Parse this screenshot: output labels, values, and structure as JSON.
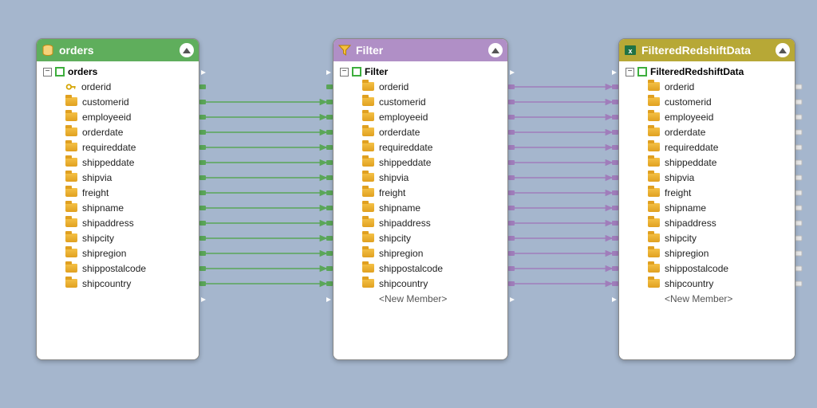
{
  "colors": {
    "bg": "#a5b6cd",
    "green": "#5fae5c",
    "purple": "#b08fc6",
    "olive": "#b7a836"
  },
  "panels": {
    "orders": {
      "title": "orders",
      "root": "orders",
      "rootToggle": "−",
      "fields": [
        "orderid",
        "customerid",
        "employeeid",
        "orderdate",
        "requireddate",
        "shippeddate",
        "shipvia",
        "freight",
        "shipname",
        "shipaddress",
        "shipcity",
        "shipregion",
        "shippostalcode",
        "shipcountry"
      ],
      "keyField": "orderid",
      "newMember": ""
    },
    "filter": {
      "title": "Filter",
      "root": "Filter",
      "rootToggle": "−",
      "fields": [
        "orderid",
        "customerid",
        "employeeid",
        "orderdate",
        "requireddate",
        "shippeddate",
        "shipvia",
        "freight",
        "shipname",
        "shipaddress",
        "shipcity",
        "shipregion",
        "shippostalcode",
        "shipcountry"
      ],
      "newMember": "<New Member>"
    },
    "filtered": {
      "title": "FilteredRedshiftData",
      "root": "FilteredRedshiftData",
      "rootToggle": "−",
      "fields": [
        "orderid",
        "customerid",
        "employeeid",
        "orderdate",
        "requireddate",
        "shippeddate",
        "shipvia",
        "freight",
        "shipname",
        "shipaddress",
        "shipcity",
        "shipregion",
        "shippostalcode",
        "shipcountry"
      ],
      "newMember": "<New Member>"
    }
  }
}
